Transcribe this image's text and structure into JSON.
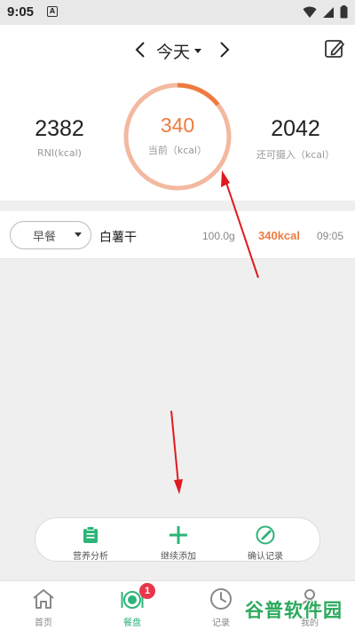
{
  "status_bar": {
    "time": "9:05",
    "notification_glyph": "A"
  },
  "header": {
    "date_label": "今天"
  },
  "summary": {
    "rni_value": "2382",
    "rni_label": "RNI(kcal)",
    "current_value": "340",
    "current_label": "当前（kcal）",
    "remaining_value": "2042",
    "remaining_label": "还可摄入（kcal）",
    "progress_fraction": 0.143
  },
  "entry": {
    "meal": "早餐",
    "food": "白薯干",
    "weight": "100.0g",
    "kcal": "340kcal",
    "time": "09:05"
  },
  "actions": [
    {
      "label": "营养分析",
      "icon": "clipboard-icon"
    },
    {
      "label": "继续添加",
      "icon": "plus-icon"
    },
    {
      "label": "确认记录",
      "icon": "check-circle-icon"
    }
  ],
  "tabs": [
    {
      "label": "首页",
      "icon": "home-icon"
    },
    {
      "label": "餐盘",
      "icon": "plate-icon",
      "badge": "1"
    },
    {
      "label": "记录",
      "icon": "clock-icon"
    },
    {
      "label": "我的",
      "icon": "profile-icon"
    }
  ],
  "watermark": "谷普软件园",
  "colors": {
    "accent": "#ed7b3f",
    "green": "#2db479",
    "ring_track": "#f3b9a0",
    "badge": "#e8374a",
    "annotation_arrow": "#e0191f"
  }
}
